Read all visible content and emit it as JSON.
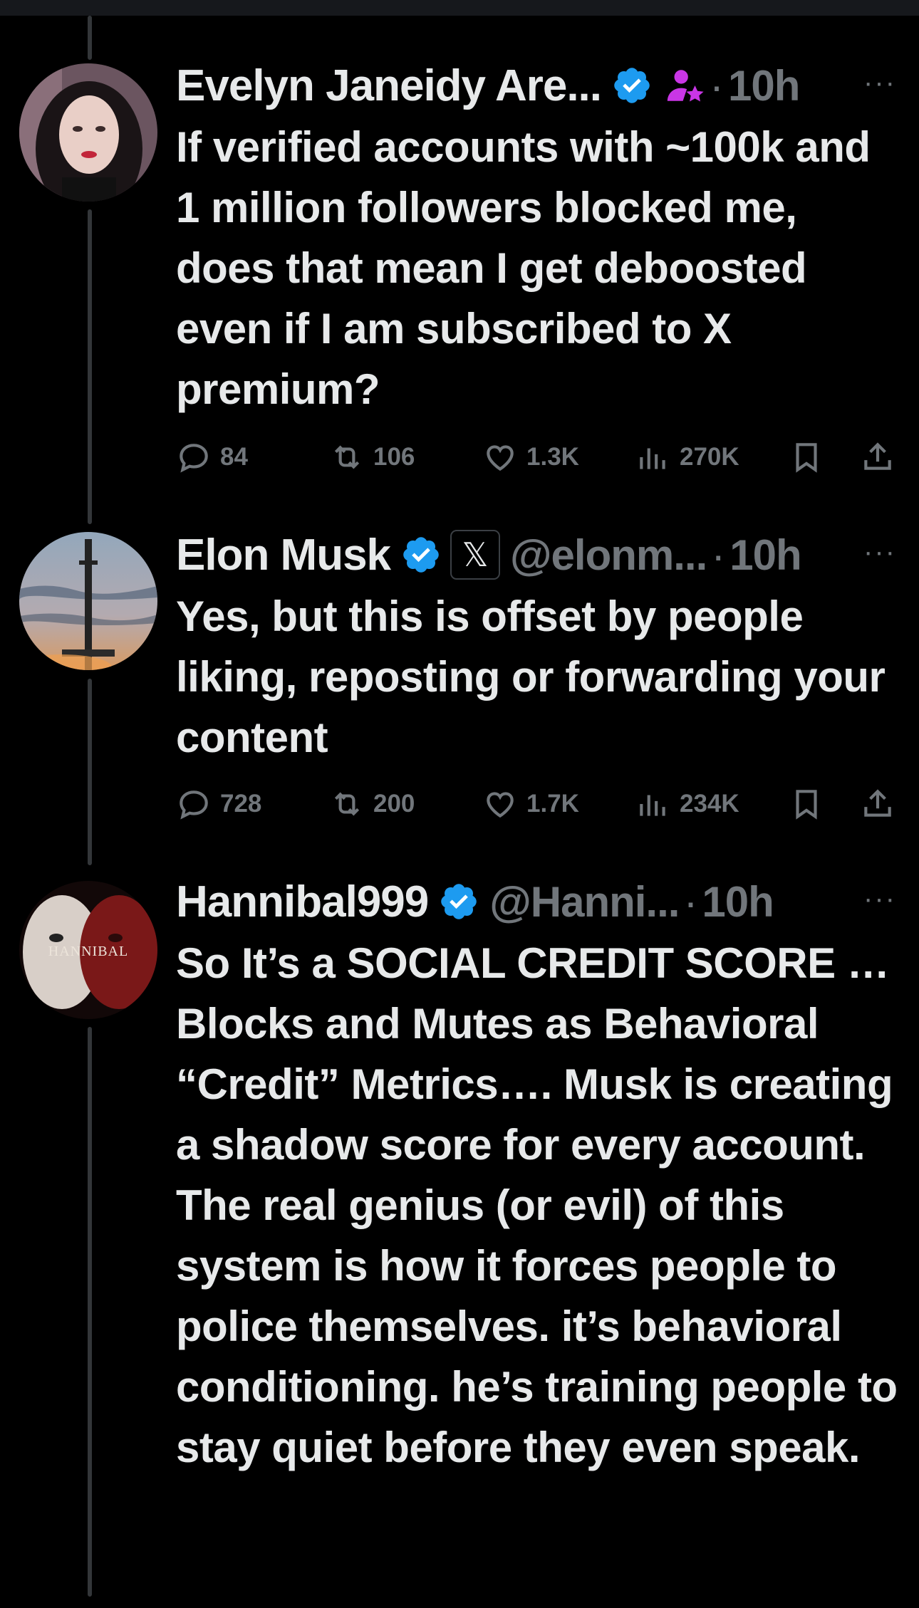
{
  "tweets": [
    {
      "author": "Evelyn Janeidy Are...",
      "handle": "",
      "time": "10h",
      "text": "If verified accounts with ~100k and 1 million followers blocked me, does that mean I get deboosted even if I am subscribed to X premium?",
      "replies": "84",
      "reposts": "106",
      "likes": "1.3K",
      "views": "270K"
    },
    {
      "author": "Elon Musk",
      "handle": "@elonm...",
      "time": "10h",
      "text": "Yes, but this is offset by people liking, reposting or forwarding your content",
      "replies": "728",
      "reposts": "200",
      "likes": "1.7K",
      "views": "234K"
    },
    {
      "author": "Hannibal999",
      "handle": "@Hanni...",
      "time": "10h",
      "avatar_text": "HANNIBAL",
      "text": "So It’s a SOCIAL CREDIT SCORE … Blocks and Mutes as Behavioral “Credit” Metrics…. Musk is creating a shadow score for every account. The real genius (or evil) of this system is how it forces people to police themselves. it’s behavioral conditioning. he’s training people to stay quiet before they even speak."
    }
  ],
  "colors": {
    "accent_verified": "#1d9bf0",
    "secondary_text": "#71767b",
    "purple_badge": "#c936e6"
  },
  "icons": [
    "verified-badge-icon",
    "subscriber-badge-icon",
    "x-logo-icon",
    "reply-icon",
    "repost-icon",
    "like-icon",
    "views-icon",
    "bookmark-icon",
    "share-icon",
    "more-icon"
  ]
}
